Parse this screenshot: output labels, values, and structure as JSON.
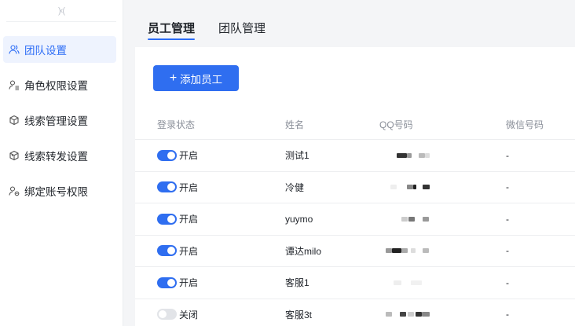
{
  "sidebar": {
    "collapse_glyph": ")‹(",
    "items": [
      {
        "label": "团队设置",
        "icon": "team-icon",
        "active": true
      },
      {
        "label": "角色权限设置",
        "icon": "user-role-icon",
        "active": false
      },
      {
        "label": "线索管理设置",
        "icon": "box-icon",
        "active": false
      },
      {
        "label": "线索转发设置",
        "icon": "cube-forward-icon",
        "active": false
      },
      {
        "label": "绑定账号权限",
        "icon": "user-bind-icon",
        "active": false
      }
    ]
  },
  "tabs": [
    {
      "label": "员工管理",
      "active": true
    },
    {
      "label": "团队管理",
      "active": false
    }
  ],
  "toolbar": {
    "add_label": "添加员工"
  },
  "table": {
    "headers": [
      "登录状态",
      "姓名",
      "QQ号码",
      "微信号码"
    ],
    "rows": [
      {
        "enabled": true,
        "status": "开启",
        "name": "测试1",
        "wechat": "-"
      },
      {
        "enabled": true,
        "status": "开启",
        "name": "冷健",
        "wechat": "-"
      },
      {
        "enabled": true,
        "status": "开启",
        "name": "yuymo",
        "wechat": "-"
      },
      {
        "enabled": true,
        "status": "开启",
        "name": "谭达milo",
        "wechat": "-"
      },
      {
        "enabled": true,
        "status": "开启",
        "name": "客服1",
        "wechat": "-"
      },
      {
        "enabled": false,
        "status": "关闭",
        "name": "客服3t",
        "wechat": "-"
      }
    ]
  },
  "colors": {
    "accent": "#2f6ef0",
    "active_bg": "#eef3fe",
    "switch_off": "#e2e4e8"
  }
}
